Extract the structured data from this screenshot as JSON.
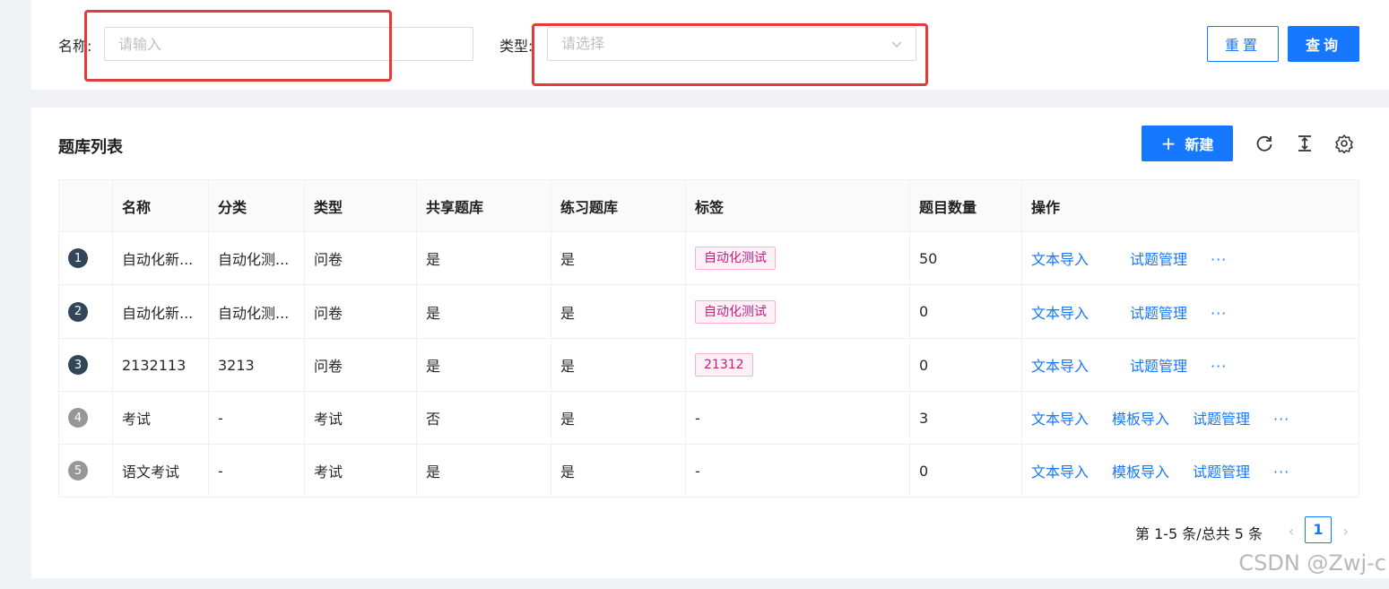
{
  "search": {
    "name_label": "名称:",
    "name_placeholder": "请输入",
    "type_label": "类型:",
    "type_placeholder": "请选择",
    "reset_label": "重置",
    "query_label": "查询"
  },
  "card": {
    "title": "题库列表",
    "new_label": "新建"
  },
  "table": {
    "columns": [
      "名称",
      "分类",
      "类型",
      "共享题库",
      "练习题库",
      "标签",
      "题目数量",
      "操作"
    ],
    "rows": [
      {
        "index": "1",
        "name": "自动化新...",
        "category": "自动化测...",
        "type": "问卷",
        "shared": "是",
        "practice": "是",
        "tag": "自动化测试",
        "count": "50",
        "ops": [
          "文本导入",
          "试题管理"
        ]
      },
      {
        "index": "2",
        "name": "自动化新...",
        "category": "自动化测...",
        "type": "问卷",
        "shared": "是",
        "practice": "是",
        "tag": "自动化测试",
        "count": "0",
        "ops": [
          "文本导入",
          "试题管理"
        ]
      },
      {
        "index": "3",
        "name": "2132113",
        "category": "3213",
        "type": "问卷",
        "shared": "是",
        "practice": "是",
        "tag": "21312",
        "count": "0",
        "ops": [
          "文本导入",
          "试题管理"
        ]
      },
      {
        "index": "4",
        "name": "考试",
        "category": "-",
        "type": "考试",
        "shared": "否",
        "practice": "是",
        "tag": "-",
        "count": "3",
        "ops": [
          "文本导入",
          "模板导入",
          "试题管理"
        ]
      },
      {
        "index": "5",
        "name": "语文考试",
        "category": "-",
        "type": "考试",
        "shared": "是",
        "practice": "是",
        "tag": "-",
        "count": "0",
        "ops": [
          "文本导入",
          "模板导入",
          "试题管理"
        ]
      }
    ],
    "more": "···"
  },
  "pagination": {
    "summary": "第 1-5 条/总共 5 条",
    "current_page": "1",
    "prev": "‹",
    "next": "›"
  },
  "watermark": "CSDN @Zwj-c",
  "colors": {
    "primary": "#1677ff",
    "highlight": "#e53a3a",
    "tag_text": "#c41d7f",
    "tag_bg": "#fff0f6",
    "index_dark": "#314659",
    "index_light": "#979797"
  }
}
